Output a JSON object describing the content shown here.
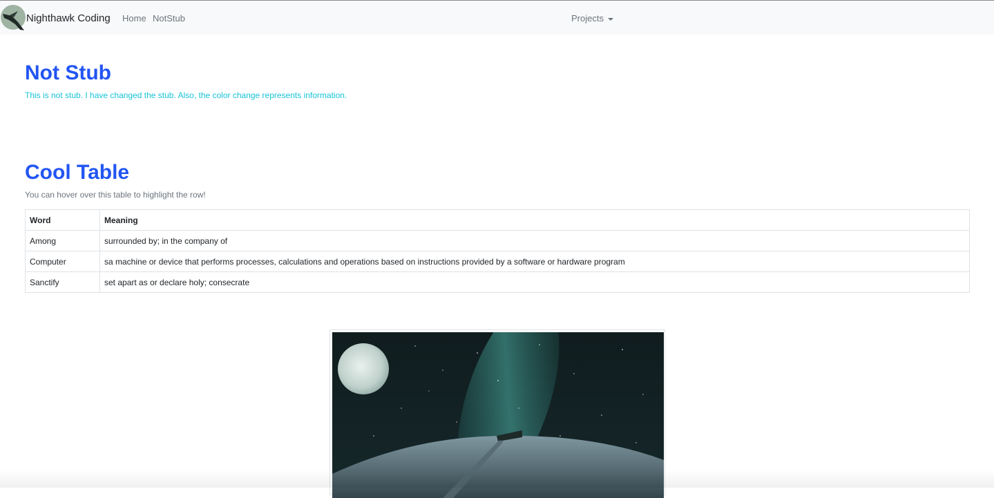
{
  "navbar": {
    "brand": "Nighthawk Coding",
    "links": [
      {
        "label": "Home"
      },
      {
        "label": "NotStub"
      }
    ],
    "dropdown": {
      "label": "Projects"
    }
  },
  "notstub": {
    "title": "Not Stub",
    "description": "This is not stub. I have changed the stub. Also, the color change represents information."
  },
  "cool_table": {
    "title": "Cool Table",
    "description": "You can hover over this table to highlight the row!",
    "headers": [
      "Word",
      "Meaning"
    ],
    "rows": [
      {
        "word": "Among",
        "meaning": "surrounded by; in the company of"
      },
      {
        "word": "Computer",
        "meaning": "sa machine or device that performs processes, calculations and operations based on instructions provided by a software or hardware program"
      },
      {
        "word": "Sanctify",
        "meaning": "set apart as or declare holy; consecrate"
      }
    ]
  },
  "colors": {
    "heading": "#2255f2",
    "accent_text": "#17c3d8",
    "navbar_bg": "#f8f9fa"
  }
}
